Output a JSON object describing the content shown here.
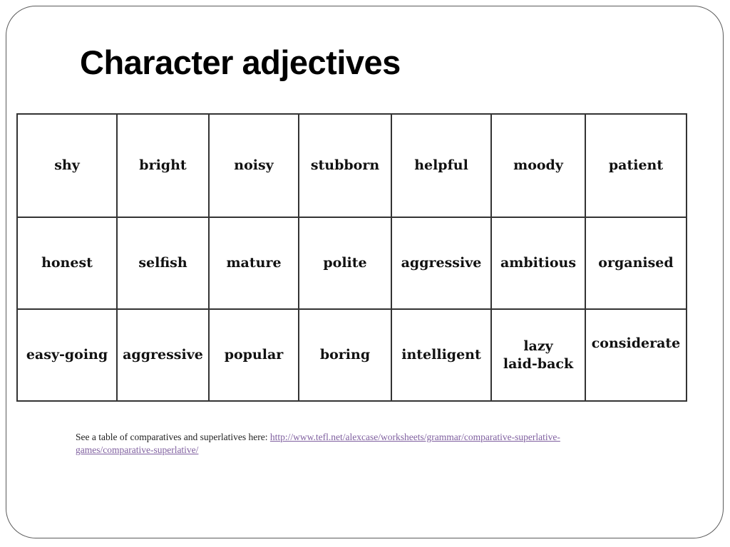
{
  "slide": {
    "title": "Character adjectives",
    "table": {
      "rows": [
        [
          "shy",
          "bright",
          "noisy",
          "stubborn",
          "helpful",
          "moody",
          "patient"
        ],
        [
          "honest",
          "selfish",
          "mature",
          "polite",
          "aggressive",
          "ambitious",
          "organised"
        ],
        [
          "easy-going",
          "aggressive",
          "popular",
          "boring",
          "intelligent",
          [
            "lazy",
            "laid-back"
          ],
          "considerate"
        ]
      ]
    },
    "note": {
      "text": "See a table of comparatives and superlatives here: ",
      "link_line1": "http://www.tefl.net/alexcase/worksheets/grammar/comparative-superlative-",
      "link_line2": "games/comparative-superlative/",
      "link_color": "#7f5f9f"
    }
  }
}
